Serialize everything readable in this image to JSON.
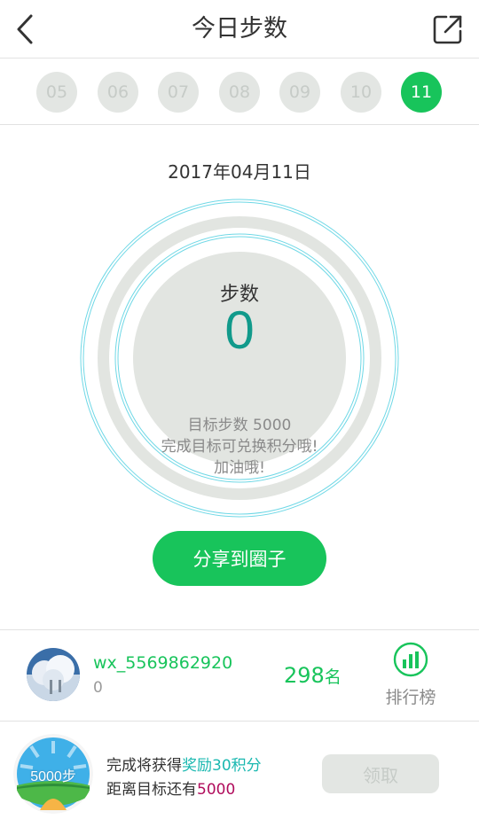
{
  "header": {
    "title": "今日步数"
  },
  "days": [
    {
      "label": "05",
      "active": false
    },
    {
      "label": "06",
      "active": false
    },
    {
      "label": "07",
      "active": false
    },
    {
      "label": "08",
      "active": false
    },
    {
      "label": "09",
      "active": false
    },
    {
      "label": "10",
      "active": false
    },
    {
      "label": "11",
      "active": true
    }
  ],
  "date": "2017年04月11日",
  "progress": {
    "label": "步数",
    "value": "0",
    "goal": "目标步数 5000",
    "message1": "完成目标可兑换积分哦!",
    "message2": "加油哦!"
  },
  "share_circle_label": "分享到圈子",
  "user": {
    "name": "wx_5569862920",
    "steps": "0",
    "rank": "298",
    "rank_unit": "名",
    "leaderboard_label": "排行榜"
  },
  "reward": {
    "badge": "5000步",
    "line1_prefix": "完成将获得",
    "line1_highlight": "奖励30积分",
    "line2_prefix": "距离目标还有",
    "line2_highlight": "5000",
    "claim_label": "领取"
  },
  "colors": {
    "accent": "#18c45b",
    "step_value": "#119a8b",
    "disabled": "#e3e6e3",
    "reward_highlight": "#1ab8b0",
    "remain_highlight": "#b00c5c"
  }
}
